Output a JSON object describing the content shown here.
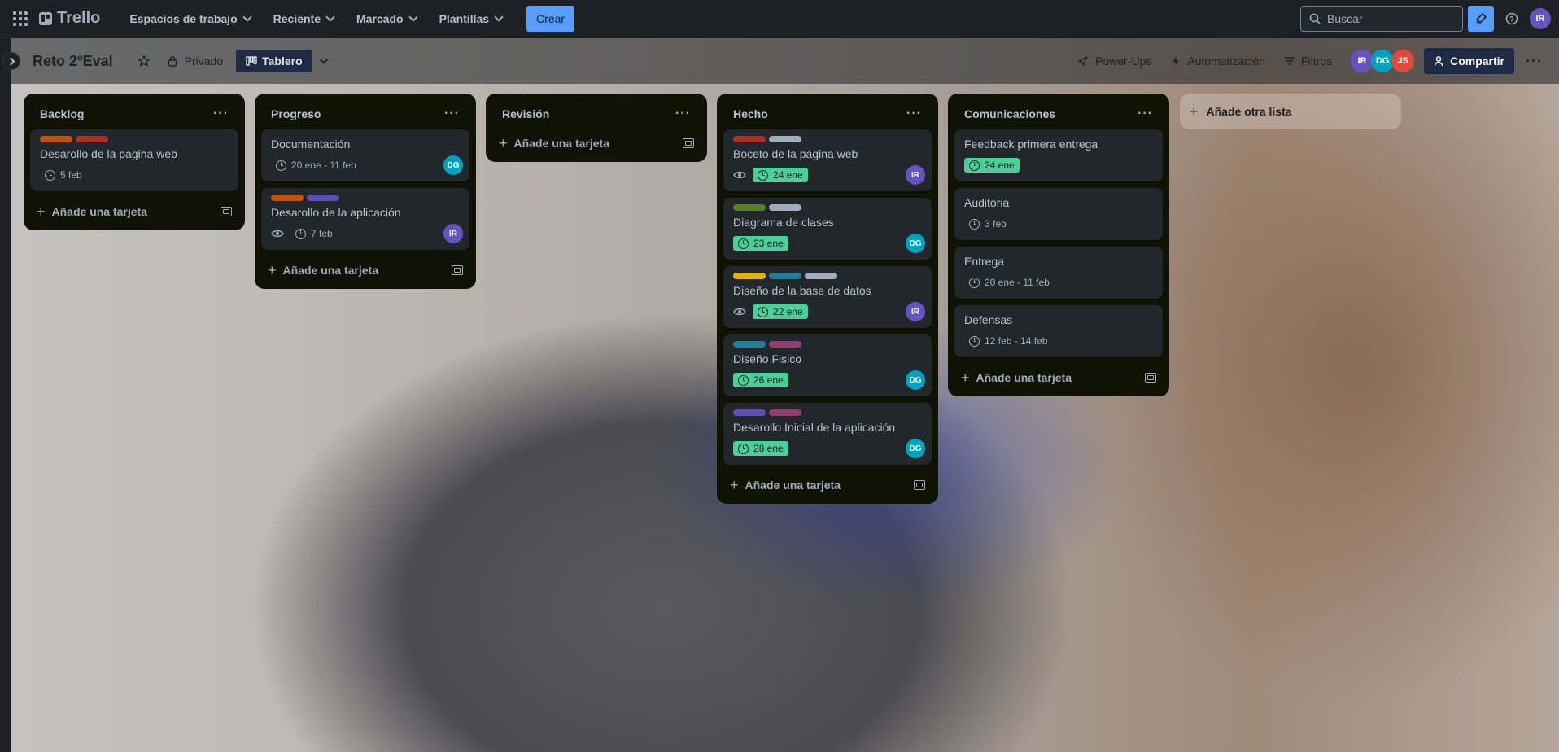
{
  "topbar": {
    "brand": "Trello",
    "nav": [
      "Espacios de trabajo",
      "Reciente",
      "Marcado",
      "Plantillas"
    ],
    "create_label": "Crear",
    "search_placeholder": "Buscar",
    "user_initials": "IR"
  },
  "board": {
    "title": "Reto 2ºEval",
    "visibility": "Privado",
    "view": "Tablero",
    "powerups": "Power-Ups",
    "automation": "Automatización",
    "filters": "Filtros",
    "share": "Compartir",
    "members": [
      {
        "initials": "IR",
        "color": "#6554c0"
      },
      {
        "initials": "DG",
        "color": "#00a3bf"
      },
      {
        "initials": "JS",
        "color": "#e2483d"
      }
    ]
  },
  "add_card_label": "Añade una tarjeta",
  "add_list_label": "Añade otra lista",
  "lists": [
    {
      "title": "Backlog",
      "cards": [
        {
          "title": "Desarollo de la pagina web",
          "labels": [
            "#c25100",
            "#ae2e24"
          ],
          "date": "5 feb",
          "done": false,
          "watch": false,
          "avatar": null
        }
      ]
    },
    {
      "title": "Progreso",
      "cards": [
        {
          "title": "Documentación",
          "labels": [],
          "date": "20 ene - 11 feb",
          "done": false,
          "watch": false,
          "avatar": "DG"
        },
        {
          "title": "Desarollo de la aplicación",
          "labels": [
            "#c25100",
            "#5e4db2"
          ],
          "date": "7 feb",
          "done": false,
          "watch": true,
          "avatar": "IR"
        }
      ]
    },
    {
      "title": "Revisión",
      "cards": []
    },
    {
      "title": "Hecho",
      "cards": [
        {
          "title": "Boceto de la página web",
          "labels": [
            "#ae2e24",
            "#9fadbc"
          ],
          "date": "24 ene",
          "done": true,
          "watch": true,
          "avatar": "IR"
        },
        {
          "title": "Diagrama de clases",
          "labels": [
            "#5b7f24",
            "#9fadbc"
          ],
          "date": "23 ene",
          "done": true,
          "watch": false,
          "avatar": "DG"
        },
        {
          "title": "Diseño de la base de datos",
          "labels": [
            "#e2b203",
            "#227d9b",
            "#9fadbc"
          ],
          "date": "22 ene",
          "done": true,
          "watch": true,
          "avatar": "IR"
        },
        {
          "title": "Diseño Fisico",
          "labels": [
            "#227d9b",
            "#943d73"
          ],
          "date": "26 ene",
          "done": true,
          "watch": false,
          "avatar": "DG"
        },
        {
          "title": "Desarollo Inicial de la aplicación",
          "labels": [
            "#5e4db2",
            "#943d73"
          ],
          "date": "28 ene",
          "done": true,
          "watch": false,
          "avatar": "DG"
        }
      ]
    },
    {
      "title": "Comunicaciones",
      "cards": [
        {
          "title": "Feedback primera entrega",
          "labels": [],
          "date": "24 ene",
          "done": true,
          "watch": false,
          "avatar": null
        },
        {
          "title": "Auditoria",
          "labels": [],
          "date": "3 feb",
          "done": false,
          "watch": false,
          "avatar": null
        },
        {
          "title": "Entrega",
          "labels": [],
          "date": "20 ene - 11 feb",
          "done": false,
          "watch": false,
          "avatar": null
        },
        {
          "title": "Defensas",
          "labels": [],
          "date": "12 feb - 14 feb",
          "done": false,
          "watch": false,
          "avatar": null
        }
      ]
    }
  ],
  "avatar_colors": {
    "IR": "#6554c0",
    "DG": "#00a3bf"
  }
}
